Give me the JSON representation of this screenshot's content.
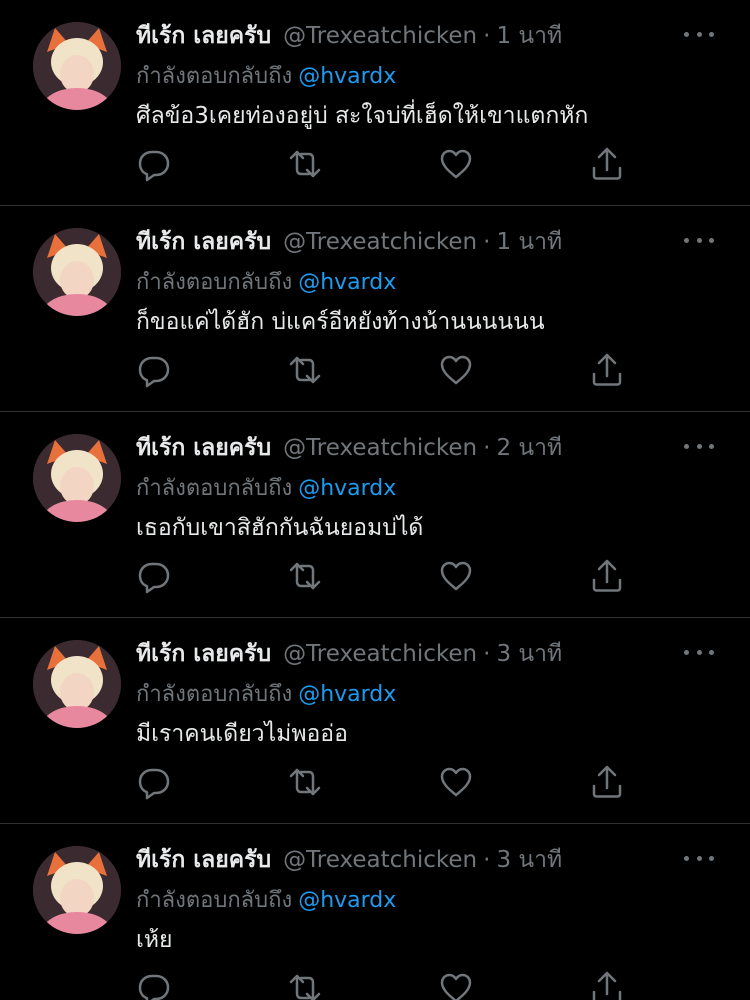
{
  "reply_prefix": "กำลังตอบกลับถึง",
  "tweets": [
    {
      "display_name": "ทีเร้ก เลยครับ",
      "handle": "@Trexeatchicken",
      "dot": "·",
      "time": "1 นาที",
      "reply_to": "@hvardx",
      "text": "ศีลข้อ3เคยท่องอยู่บ่ สะใจบ่ที่เฮ็ดให้เขาแตกหัก"
    },
    {
      "display_name": "ทีเร้ก เลยครับ",
      "handle": "@Trexeatchicken",
      "dot": "·",
      "time": "1 นาที",
      "reply_to": "@hvardx",
      "text": "ก็ขอแค่ได้ฮัก บ่แคร์อีหยังท้างน้านนนนนน"
    },
    {
      "display_name": "ทีเร้ก เลยครับ",
      "handle": "@Trexeatchicken",
      "dot": "·",
      "time": "2 นาที",
      "reply_to": "@hvardx",
      "text": "เธอกับเขาสิฮักกันฉันยอมบ่ได้"
    },
    {
      "display_name": "ทีเร้ก เลยครับ",
      "handle": "@Trexeatchicken",
      "dot": "·",
      "time": "3 นาที",
      "reply_to": "@hvardx",
      "text": "มีเราคนเดียวไม่พออ่อ"
    },
    {
      "display_name": "ทีเร้ก เลยครับ",
      "handle": "@Trexeatchicken",
      "dot": "·",
      "time": "3 นาที",
      "reply_to": "@hvardx",
      "text": "เห้ย"
    }
  ],
  "icons": {
    "reply": "reply-icon",
    "retweet": "retweet-icon",
    "like": "heart-icon",
    "share": "share-icon",
    "more": "more-icon"
  },
  "colors": {
    "background": "#000000",
    "text": "#e7e9ea",
    "secondary": "#71767b",
    "mention": "#1d9bf0",
    "divider": "#2f3336"
  }
}
